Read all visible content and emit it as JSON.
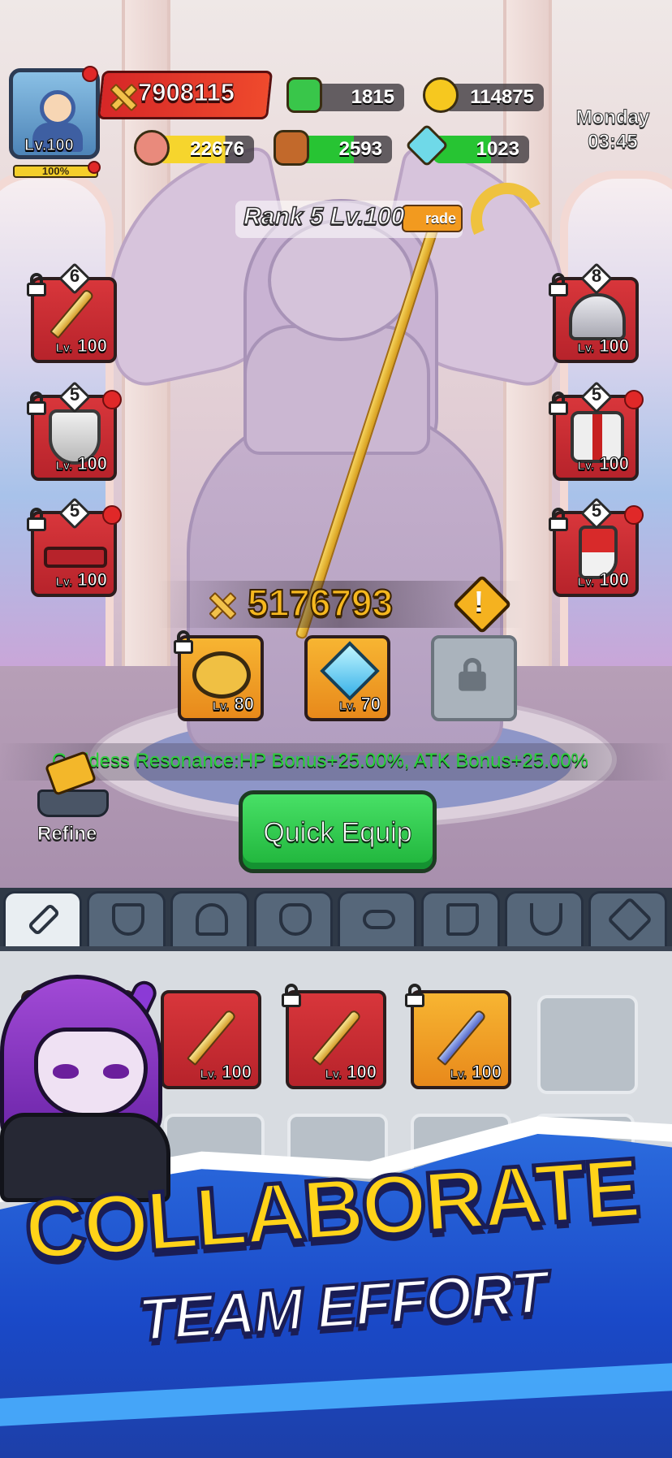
{
  "player": {
    "level_label": "Lv.100",
    "exp_percent_label": "100%",
    "exp_fraction": 1.0
  },
  "resources": {
    "power": "7908115",
    "green_gems": "1815",
    "gold": "114875",
    "meat": "22676",
    "wood": "2593",
    "crystal": "1023"
  },
  "clock": {
    "day": "Monday",
    "time": "03:45"
  },
  "statue": {
    "rank_label": "Rank 5 Lv.100",
    "upgrade_label": "rade",
    "power": "5176793",
    "resonance_text": "Goddess Resonance:HP Bonus+25.00%, ATK Bonus+25.00%"
  },
  "equipment_left": [
    {
      "name": "sword",
      "stars": "6",
      "level": "100",
      "locked": true,
      "alert": false
    },
    {
      "name": "shield",
      "stars": "5",
      "level": "100",
      "locked": true,
      "alert": true
    },
    {
      "name": "belt",
      "stars": "5",
      "level": "100",
      "locked": true,
      "alert": true
    }
  ],
  "equipment_right": [
    {
      "name": "helmet",
      "stars": "8",
      "level": "100",
      "locked": true,
      "alert": false
    },
    {
      "name": "armor",
      "stars": "5",
      "level": "100",
      "locked": true,
      "alert": true
    },
    {
      "name": "boots",
      "stars": "5",
      "level": "100",
      "locked": true,
      "alert": true
    }
  ],
  "accessories": [
    {
      "name": "ring",
      "level": "80",
      "locked": true
    },
    {
      "name": "gem",
      "level": "70",
      "locked": false
    },
    {
      "name": "locked-slot",
      "level": "",
      "locked": true
    }
  ],
  "buttons": {
    "refine": "Refine",
    "quick_equip": "Quick Equip"
  },
  "tabs": [
    {
      "icon": "sword-icon",
      "active": true
    },
    {
      "icon": "shield-icon",
      "active": false
    },
    {
      "icon": "helmet-icon",
      "active": false
    },
    {
      "icon": "armor-icon",
      "active": false
    },
    {
      "icon": "belt-icon",
      "active": false
    },
    {
      "icon": "boots-icon",
      "active": false
    },
    {
      "icon": "necklace-icon",
      "active": false
    },
    {
      "icon": "star-icon",
      "active": false
    }
  ],
  "inventory": [
    {
      "name": "red-sword",
      "level": "100",
      "locked": false
    },
    {
      "name": "red-sword",
      "level": "100",
      "locked": true
    },
    {
      "name": "blue-sword",
      "level": "100",
      "locked": true
    }
  ],
  "promo": {
    "headline": "COLLABORATE",
    "subline": "TEAM EFFORT"
  },
  "colors": {
    "accent_green": "#27c433",
    "power_gold": "#f6b81f",
    "banner_blue": "#1a49c8",
    "headline_yellow": "#ffd319"
  }
}
